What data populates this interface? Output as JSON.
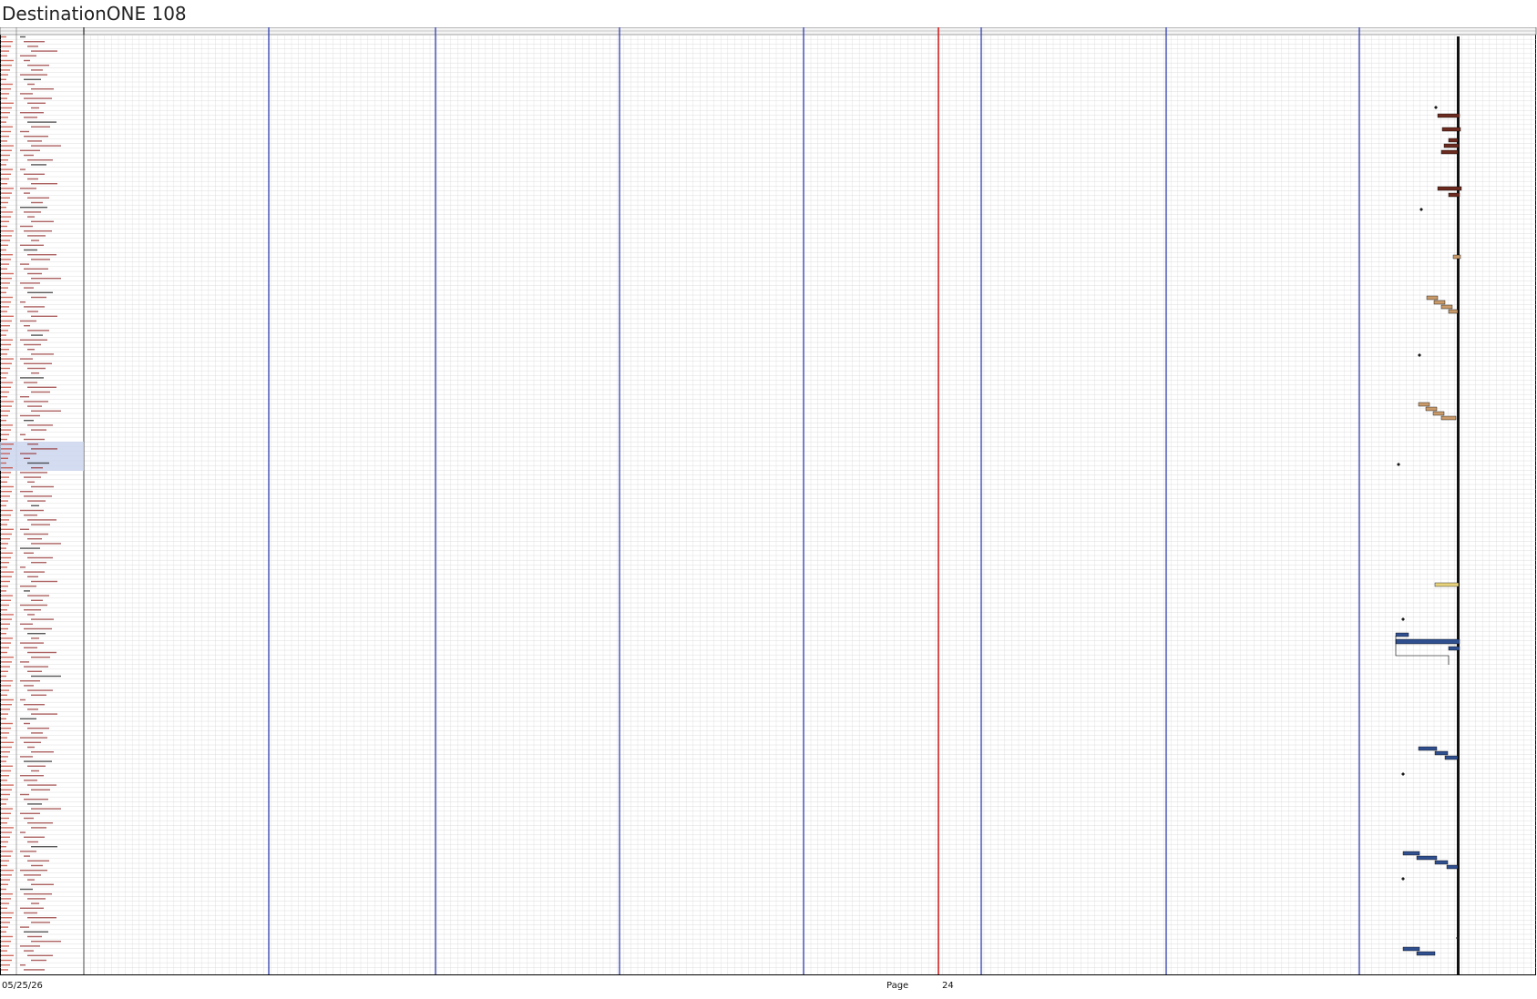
{
  "document": {
    "title": "DestinationONE 108"
  },
  "footer": {
    "date": "05/25/26",
    "page_label": "Page",
    "page_number": "24"
  },
  "colors": {
    "grid": "#d6d6d6",
    "border": "#000000",
    "week_divider": "#2f3fb0",
    "today_line": "#d42020",
    "code_text": "#c0392b",
    "name_text": "#8a1f1f",
    "summary_bar": "#111111",
    "bar_brown": "#6b2a1f",
    "bar_tan": "#c99a6a",
    "bar_yellow": "#e6d27a",
    "bar_blue": "#2f4f8f",
    "milestone": "#1a1a1a",
    "selection": "#c9d3ee"
  }
}
